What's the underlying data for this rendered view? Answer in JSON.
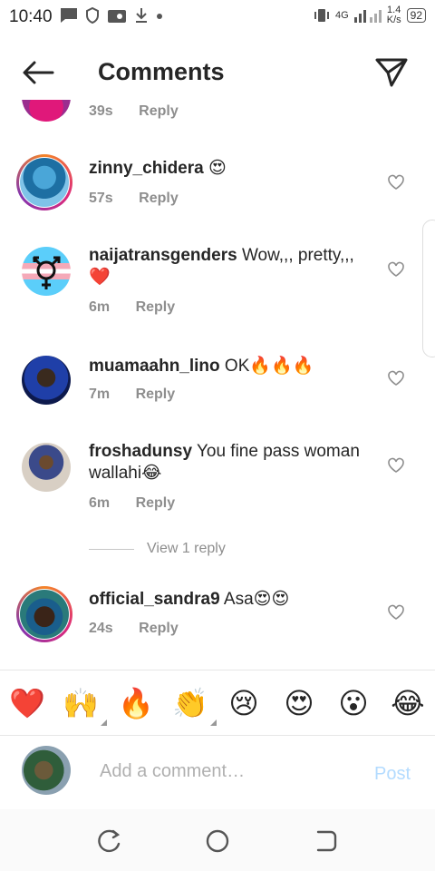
{
  "status": {
    "time": "10:40",
    "network": "4G",
    "speed_top": "1.4",
    "speed_bottom": "K/s",
    "battery": "92"
  },
  "header": {
    "title": "Comments"
  },
  "partial_comment": {
    "time": "39s",
    "reply": "Reply"
  },
  "comments": [
    {
      "username": "zinny_chidera",
      "text": " 😍",
      "time": "57s",
      "reply": "Reply"
    },
    {
      "username": "naijatransgenders",
      "text": " Wow,,, pretty,,, ❤️",
      "time": "6m",
      "reply": "Reply"
    },
    {
      "username": "muamaahn_lino",
      "text": " OK🔥🔥🔥",
      "time": "7m",
      "reply": "Reply"
    },
    {
      "username": "froshadunsy",
      "text": " You fine pass woman wallahi😂",
      "time": "6m",
      "reply": "Reply"
    },
    {
      "username": "official_sandra9",
      "text": " Asa😍😍",
      "time": "24s",
      "reply": "Reply"
    }
  ],
  "view_replies": "View 1 reply",
  "emoji_bar": [
    "❤️",
    "🙌",
    "🔥",
    "👏",
    "😢",
    "😍",
    "😮",
    "😂"
  ],
  "composer": {
    "placeholder": "Add a comment…",
    "post_label": "Post"
  },
  "colors": {
    "username_text": "#262626",
    "meta_text": "#8e8e8e",
    "post_disabled": "#b3dbff",
    "story_ring": "#dd2a7b"
  }
}
